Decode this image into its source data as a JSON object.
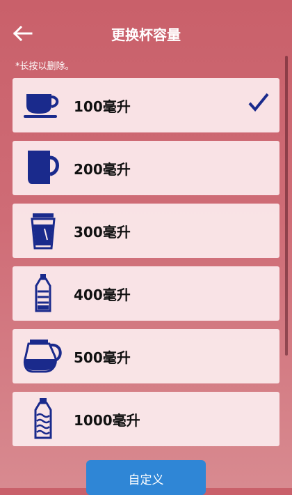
{
  "header": {
    "title": "更换杯容量",
    "back_icon": "arrow-left-icon"
  },
  "hint": "*长按以删除。",
  "colors": {
    "accent": "#2f86d6",
    "icon": "#1a2a8c",
    "card": "#fcecee"
  },
  "items": [
    {
      "label": "100毫升",
      "icon": "coffee-cup-saucer-icon",
      "selected": true
    },
    {
      "label": "200毫升",
      "icon": "mug-icon",
      "selected": false
    },
    {
      "label": "300毫升",
      "icon": "takeaway-cup-icon",
      "selected": false
    },
    {
      "label": "400毫升",
      "icon": "small-bottle-icon",
      "selected": false
    },
    {
      "label": "500毫升",
      "icon": "coffee-pot-icon",
      "selected": false
    },
    {
      "label": "1000毫升",
      "icon": "large-bottle-icon",
      "selected": false
    }
  ],
  "custom_button": "自定义"
}
